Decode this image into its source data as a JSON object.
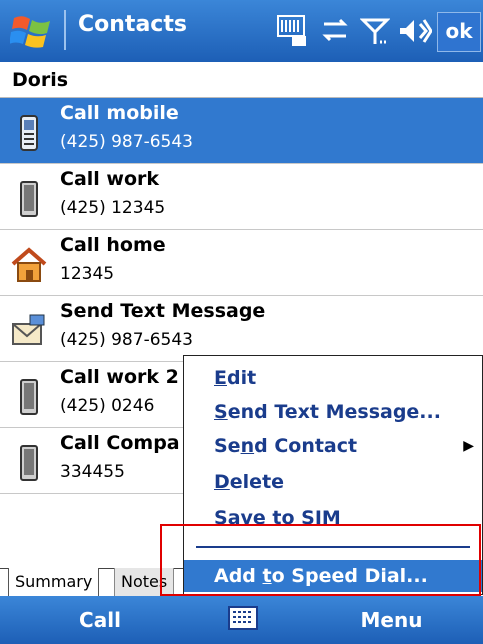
{
  "app": {
    "title": "Contacts",
    "ok_label": "ok"
  },
  "status_icons": [
    "input-panel-icon",
    "connectivity-icon",
    "signal-icon",
    "volume-icon"
  ],
  "contact": {
    "name": "Doris"
  },
  "entries": [
    {
      "label": "Call mobile",
      "value": "(425) 987-6543",
      "icon": "mobile-phone-icon",
      "selected": true
    },
    {
      "label": "Call work",
      "value": "(425) 12345",
      "icon": "desk-phone-icon"
    },
    {
      "label": "Call home",
      "value": "12345",
      "icon": "home-icon"
    },
    {
      "label": "Send Text Message",
      "value": "(425) 987-6543",
      "icon": "text-message-icon"
    },
    {
      "label": "Call work 2",
      "value": "(425) 0246",
      "icon": "desk-phone-icon"
    },
    {
      "label": "Call Compa",
      "value": "334455",
      "icon": "desk-phone-icon"
    }
  ],
  "tabs": {
    "summary": "Summary",
    "notes": "Notes"
  },
  "menubar": {
    "left": "Call",
    "right": "Menu"
  },
  "context_menu": {
    "items": [
      {
        "pre": "",
        "acc": "E",
        "post": "dit"
      },
      {
        "pre": "",
        "acc": "S",
        "post": "end Text Message..."
      },
      {
        "pre": "Se",
        "acc": "n",
        "post": "d Contact"
      },
      {
        "pre": "",
        "acc": "D",
        "post": "elete"
      },
      {
        "pre": "",
        "acc": "S",
        "post": "ave to SIM"
      },
      {
        "pre": "Add ",
        "acc": "t",
        "post": "o Speed Dial..."
      }
    ]
  },
  "colors": {
    "titlebar": "#2a6fc8",
    "selection": "#3179cf",
    "highlight_box": "#e00000",
    "menu_text": "#1a3c8c"
  }
}
